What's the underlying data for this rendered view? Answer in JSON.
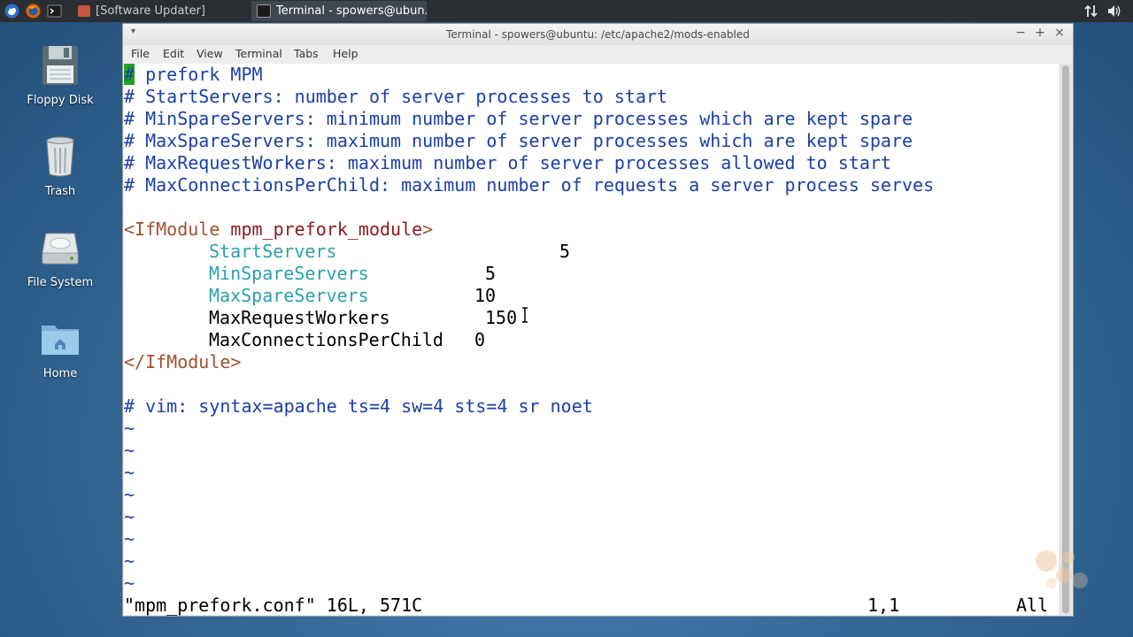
{
  "panel": {
    "tasks": [
      {
        "label": "[Software Updater]"
      },
      {
        "label": "Terminal - spowers@ubun..."
      }
    ]
  },
  "desktop": {
    "icons": [
      {
        "label": "Floppy Disk",
        "icon": "floppy-disk-icon"
      },
      {
        "label": "Trash",
        "icon": "trash-icon"
      },
      {
        "label": "File System",
        "icon": "hard-drive-icon"
      },
      {
        "label": "Home",
        "icon": "home-folder-icon"
      }
    ]
  },
  "window": {
    "title": "Terminal - spowers@ubuntu: /etc/apache2/mods-enabled",
    "menu": [
      "File",
      "Edit",
      "View",
      "Terminal",
      "Tabs",
      "Help"
    ]
  },
  "editor": {
    "lines": {
      "l1": "# prefork MPM",
      "l2": "# StartServers: number of server processes to start",
      "l3": "# MinSpareServers: minimum number of server processes which are kept spare",
      "l4": "# MaxSpareServers: maximum number of server processes which are kept spare",
      "l5": "# MaxRequestWorkers: maximum number of server processes allowed to start",
      "l6": "# MaxConnectionsPerChild: maximum number of requests a server process serves",
      "open_tag": "<IfModule",
      "module": "mpm_prefork_module",
      "open_close": ">",
      "d1_key": "StartServers",
      "d1_val": "5",
      "d2_key": "MinSpareServers",
      "d2_val": "5",
      "d3_key": "MaxSpareServers",
      "d3_val": "10",
      "d4_key": "MaxRequestWorkers",
      "d4_val": "150",
      "d5_key": "MaxConnectionsPerChild",
      "d5_val": "0",
      "close_tag": "</IfModule>",
      "modeline": "# vim: syntax=apache ts=4 sw=4 sts=4 sr noet",
      "tilde": "~"
    },
    "status": {
      "file": "\"mpm_prefork.conf\" 16L, 571C",
      "position": "1,1",
      "scroll": "All"
    }
  },
  "colors": {
    "comment": "#1a3fa8",
    "tag": "#a0522d",
    "module": "#8b1a1a",
    "directive": "#2aa1ad",
    "cursor": "#1fa51f"
  }
}
